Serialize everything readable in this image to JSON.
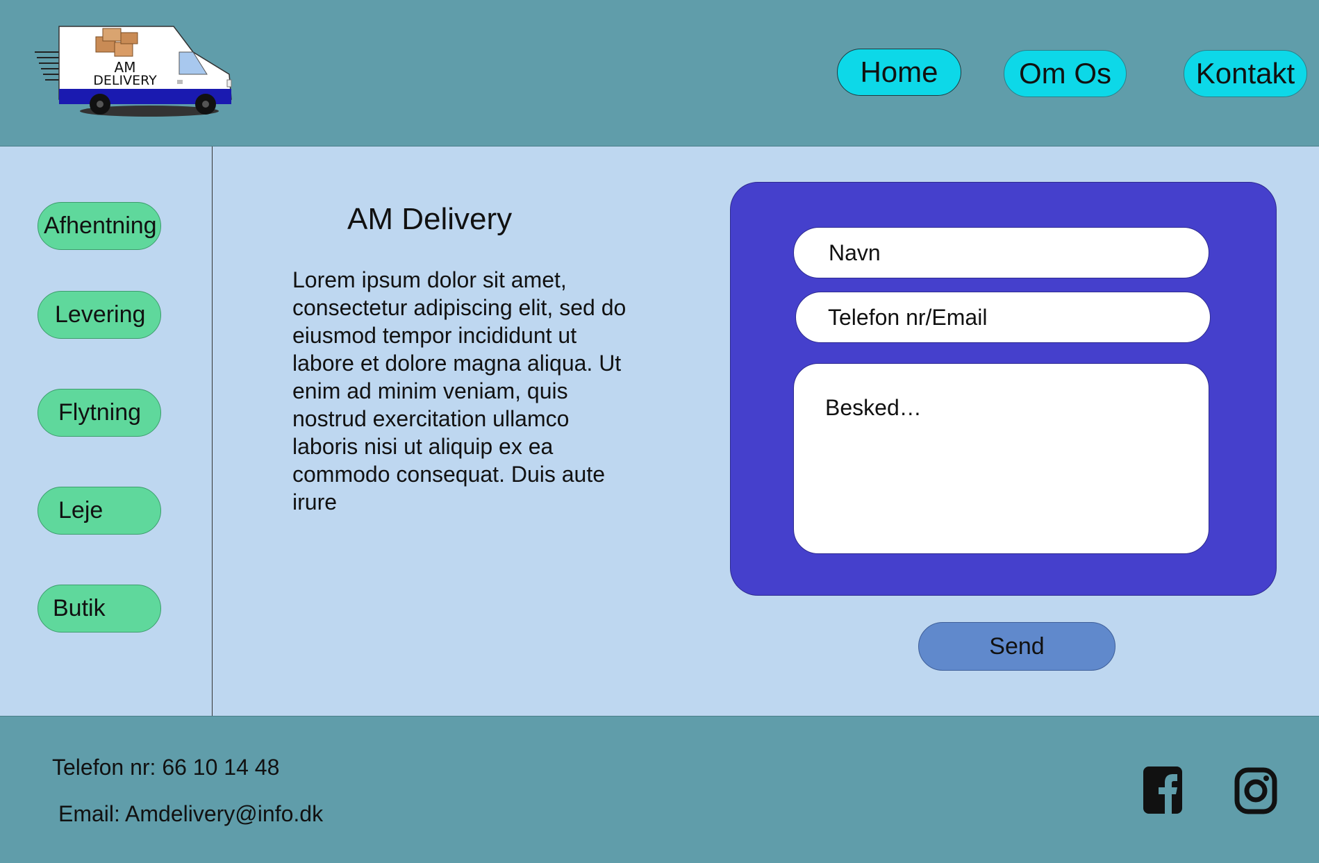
{
  "logo": {
    "line1": "AM",
    "line2": "DELIVERY",
    "icon": "delivery-van-logo"
  },
  "nav": {
    "items": [
      {
        "label": "Home",
        "active": true
      },
      {
        "label": "Om Os"
      },
      {
        "label": "Kontakt"
      }
    ]
  },
  "sidebar": {
    "items": [
      {
        "label": "Afhentning"
      },
      {
        "label": "Levering"
      },
      {
        "label": "Flytning"
      },
      {
        "label": "Leje"
      },
      {
        "label": "Butik"
      }
    ]
  },
  "main": {
    "title": "AM Delivery",
    "body": "Lorem ipsum dolor sit amet, consectetur adipiscing elit, sed do eiusmod tempor incididunt ut labore et dolore magna aliqua. Ut enim ad minim veniam, quis nostrud exercitation ullamco laboris nisi ut aliquip ex ea commodo consequat. Duis aute irure"
  },
  "form": {
    "name_placeholder": "Navn",
    "contact_placeholder": "Telefon nr/Email",
    "message_placeholder": "Besked…",
    "send_label": "Send"
  },
  "footer": {
    "phone": "Telefon nr: 66 10 14 48",
    "email": "Email: Amdelivery@info.dk",
    "social": [
      "facebook-icon",
      "instagram-icon"
    ]
  },
  "colors": {
    "header_bg": "#609daa",
    "main_bg": "#bed7f0",
    "nav_button": "#0dd8e8",
    "sidebar_button": "#5fd89c",
    "form_panel": "#4540cc",
    "send_button": "#6089cc"
  }
}
